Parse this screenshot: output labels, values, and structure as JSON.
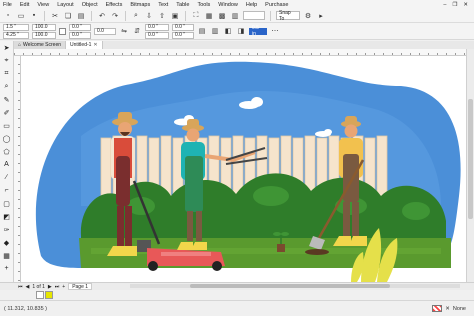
{
  "menu": [
    "File",
    "Edit",
    "View",
    "Layout",
    "Object",
    "Effects",
    "Bitmaps",
    "Text",
    "Table",
    "Tools",
    "Window",
    "Help",
    "Purchase"
  ],
  "toolbar": {
    "zoom": "",
    "snap_to_label": "Snap To"
  },
  "propbar": {
    "x_value": "1.5 \"",
    "y_value": "4.25 \"",
    "w_value": "100.0",
    "h_value": "100.0",
    "scale_x": "0.0 \"",
    "scale_y": "0.0 \"",
    "angle": "0.0",
    "pos_x": "0.0 \"",
    "pos_y": "0.0 \"",
    "nudge1": "0.0 \"",
    "nudge2": "0.0 \"",
    "selected_field": "0.5 in"
  },
  "tabs": [
    {
      "label": "Welcome Screen",
      "active": false
    },
    {
      "label": "Untitled-1",
      "active": true
    }
  ],
  "pagenav": {
    "page_label": "Page 1",
    "page_counter": "1 of 1"
  },
  "palette": [
    "#ffffff",
    "#e6e600",
    "#000000"
  ],
  "status": {
    "coords": "( 11.312, 10.835 )",
    "fill_label": "None"
  },
  "colors": {
    "sky": "#cfe3f5",
    "blob": "#4b8fd8",
    "fence": "#f5e5d0",
    "grass": "#5a9a2e",
    "hedge": "#2f7d2a",
    "mower": "#e85858",
    "shirt_teal": "#1fb3b3",
    "apron": "#2e8b57",
    "plaid": "#d94c3a",
    "skin": "#e9a574",
    "hat": "#d8a55a",
    "pants": "#7a2e2e",
    "yellow": "#f2d64b"
  }
}
